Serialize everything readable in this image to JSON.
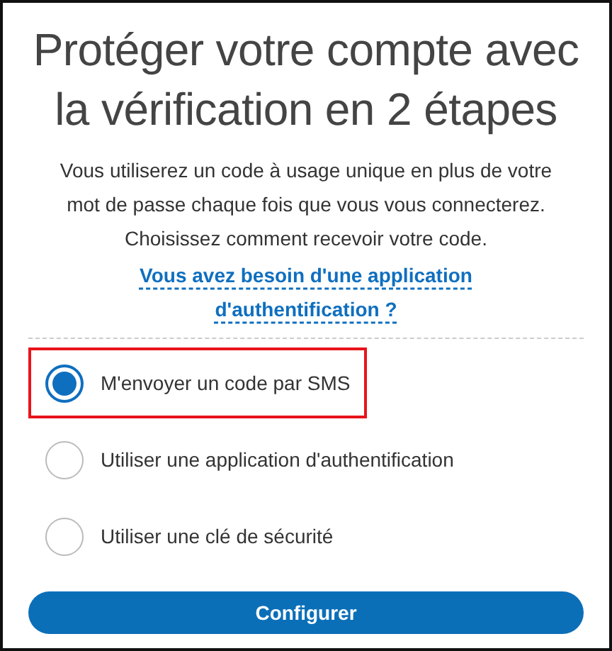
{
  "title": "Protéger votre compte avec la vérification en 2 étapes",
  "description": "Vous utiliserez un code à usage unique en plus de votre mot de passe chaque fois que vous vous connecterez. Choisissez comment recevoir votre code.",
  "help_link": "Vous avez besoin d'une application d'authentification ?",
  "options": [
    {
      "label": "M'envoyer un code par SMS",
      "selected": true,
      "highlighted": true
    },
    {
      "label": "Utiliser une application d'authentification",
      "selected": false,
      "highlighted": false
    },
    {
      "label": "Utiliser une clé de sécurité",
      "selected": false,
      "highlighted": false
    }
  ],
  "button": "Configurer"
}
